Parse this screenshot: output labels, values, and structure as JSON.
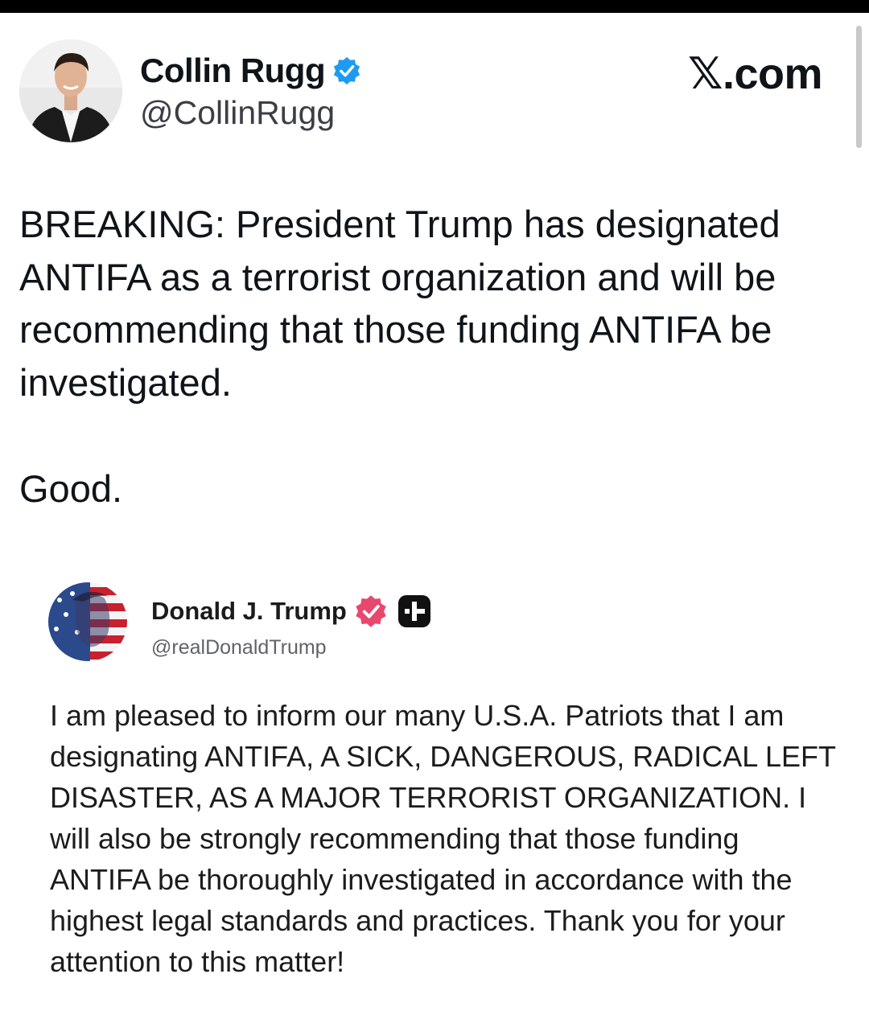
{
  "tweet": {
    "author_name": "Collin Rugg",
    "author_handle": "@CollinRugg",
    "brand": "𝕏.com",
    "body": "BREAKING: President Trump has designated ANTIFA as a terrorist organization and will be recommending that those funding ANTIFA be investigated.",
    "comment": "Good.",
    "verified_color": "#1d9bf0"
  },
  "quoted_post": {
    "author_name": "Donald J. Trump",
    "author_handle": "@realDonaldTrump",
    "body": "I am pleased to inform our many U.S.A. Patriots that I am designating ANTIFA, A SICK, DANGEROUS, RADICAL LEFT DISASTER, AS A MAJOR TERRORIST ORGANIZATION. I will also be strongly recommending that those funding ANTIFA be thoroughly investigated in accordance with the highest legal standards and practices. Thank you for your attention to this matter!",
    "badge_color": "#e8476e"
  }
}
